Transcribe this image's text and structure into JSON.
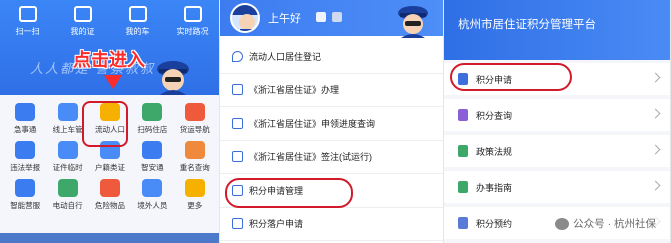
{
  "panel1": {
    "top_icons": [
      {
        "label": "扫一扫",
        "icon": "scan-icon"
      },
      {
        "label": "我的证",
        "icon": "id-card-icon"
      },
      {
        "label": "我的车",
        "icon": "car-icon"
      },
      {
        "label": "实时路况",
        "icon": "traffic-icon"
      }
    ],
    "banner_text": "人人都是 警察叔叔",
    "click_label": "点击进入",
    "grid": [
      {
        "label": "急事通",
        "color": "#3b7df0"
      },
      {
        "label": "线上车管",
        "color": "#4a8cf7"
      },
      {
        "label": "流动人口",
        "color": "#f5b000"
      },
      {
        "label": "扫码住店",
        "color": "#3ea86b"
      },
      {
        "label": "货运导航",
        "color": "#ef5a3d"
      },
      {
        "label": "违法举报",
        "color": "#3b7df0"
      },
      {
        "label": "证件临时",
        "color": "#4a8cf7"
      },
      {
        "label": "户籍类证",
        "color": "#4a8cf7"
      },
      {
        "label": "智安通",
        "color": "#3b7df0"
      },
      {
        "label": "重名查询",
        "color": "#ef8a3d"
      },
      {
        "label": "智能营服",
        "color": "#3b7df0"
      },
      {
        "label": "电动自行",
        "color": "#3ea86b"
      },
      {
        "label": "危险物品",
        "color": "#ef5a3d"
      },
      {
        "label": "境外人员",
        "color": "#4a8cf7"
      },
      {
        "label": "更多",
        "color": "#f5b000"
      }
    ]
  },
  "panel2": {
    "greeting": "上午好",
    "menu": [
      "流动人口居住登记",
      "《浙江省居住证》办理",
      "《浙江省居住证》申领进度查询",
      "《浙江省居住证》签注(试运行)",
      "积分申请管理",
      "积分落户申请"
    ]
  },
  "panel3": {
    "title": "杭州市居住证积分管理平台",
    "items": [
      {
        "label": "积分申请",
        "color": "#3d6fdc"
      },
      {
        "label": "积分查询",
        "color": "#8b5fd6"
      },
      {
        "label": "政策法规",
        "color": "#3ea86b"
      },
      {
        "label": "办事指南",
        "color": "#3ea86b"
      },
      {
        "label": "积分预约",
        "color": "#5a7ad8"
      }
    ]
  },
  "watermark": "公众号 · 杭州社保"
}
